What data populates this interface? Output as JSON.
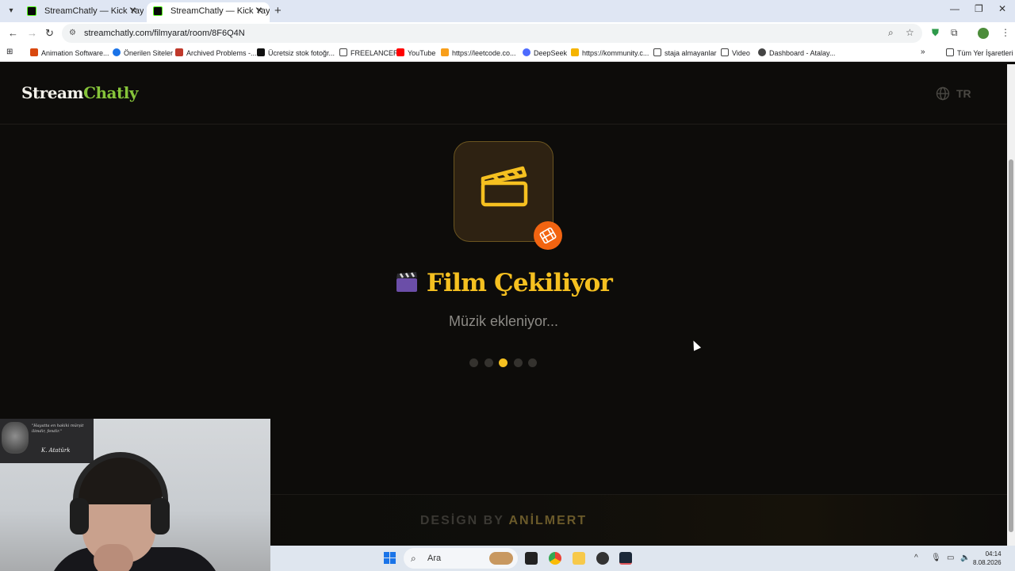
{
  "browser": {
    "tabs": [
      {
        "title": "StreamChatly — Kick Yayıncıları",
        "active": false
      },
      {
        "title": "StreamChatly — Kick Yayıncıları",
        "active": true
      }
    ],
    "url": "streamchatly.com/filmyarat/room/8F6Q4N",
    "bookmarks": [
      {
        "label": "Animation Software...",
        "icon": "animation-icon",
        "color": "#d9480f"
      },
      {
        "label": "Önerilen Siteler",
        "icon": "search-icon",
        "color": "#1a73e8"
      },
      {
        "label": "Archived Problems -...",
        "icon": "pe-icon",
        "color": "#c0392b"
      },
      {
        "label": "Ücretsiz stok fotoğr...",
        "icon": "unsplash-icon",
        "color": "#111111"
      },
      {
        "label": "FREELANCER",
        "icon": "folder-icon",
        "color": "#444444"
      },
      {
        "label": "YouTube",
        "icon": "youtube-icon",
        "color": "#ff0000"
      },
      {
        "label": "https://leetcode.co...",
        "icon": "leetcode-icon",
        "color": "#f89f1b"
      },
      {
        "label": "DeepSeek",
        "icon": "deepseek-icon",
        "color": "#4d6bfe"
      },
      {
        "label": "https://kommunity.c...",
        "icon": "kommunity-icon",
        "color": "#f5b400"
      },
      {
        "label": "staja almayanlar",
        "icon": "folder-icon",
        "color": "#444444"
      },
      {
        "label": "Video",
        "icon": "folder-icon",
        "color": "#444444"
      },
      {
        "label": "Dashboard - Atalay...",
        "icon": "globe-icon",
        "color": "#444444"
      }
    ],
    "all_bookmarks": "Tüm Yer İşaretleri"
  },
  "site": {
    "logo_part1": "Stream",
    "logo_part2": "Chatly",
    "lang": "TR",
    "title_emoji": "🎬",
    "title": "Film Çekiliyor",
    "subtitle": "Müzik ekleniyor...",
    "progress_step": 3,
    "progress_total": 5,
    "footer_prefix": "DESİGN BY",
    "footer_name": "ANİLMERT"
  },
  "colors": {
    "accent_yellow": "#f5c020",
    "logo_green": "#86c43a",
    "badge_orange": "#f26411",
    "page_bg": "#0d0c0a"
  },
  "webcam": {
    "poster_text": "\"Hayatta en hakiki mürşit ilimdir, fendir.\"",
    "signature": "K. Atatürk"
  },
  "taskbar": {
    "search_placeholder": "Ara",
    "time": "04:14",
    "date": "8.08.2026"
  }
}
